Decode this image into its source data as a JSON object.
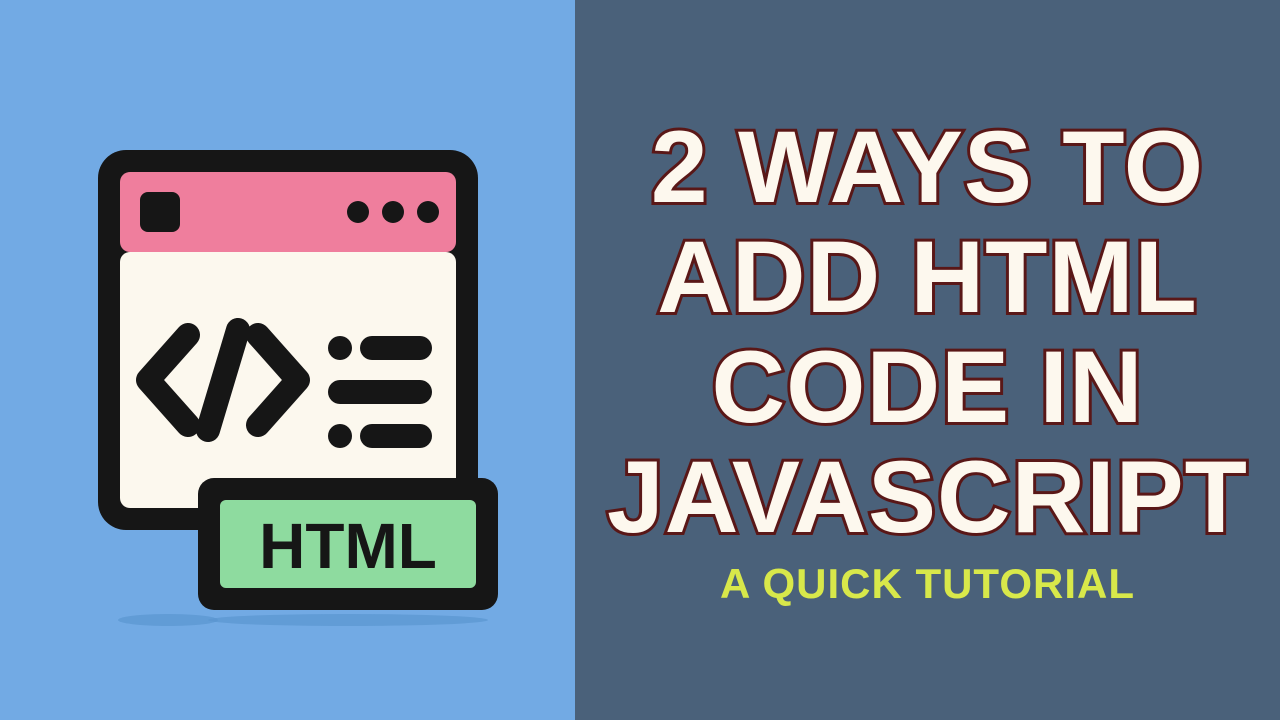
{
  "title": {
    "line1": "2 WAYS TO",
    "line2": "ADD HTML",
    "line3": "CODE IN",
    "line4": "JAVASCRIPT"
  },
  "subtitle": "A QUICK TUTORIAL",
  "icon": {
    "badge_text": "HTML"
  }
}
